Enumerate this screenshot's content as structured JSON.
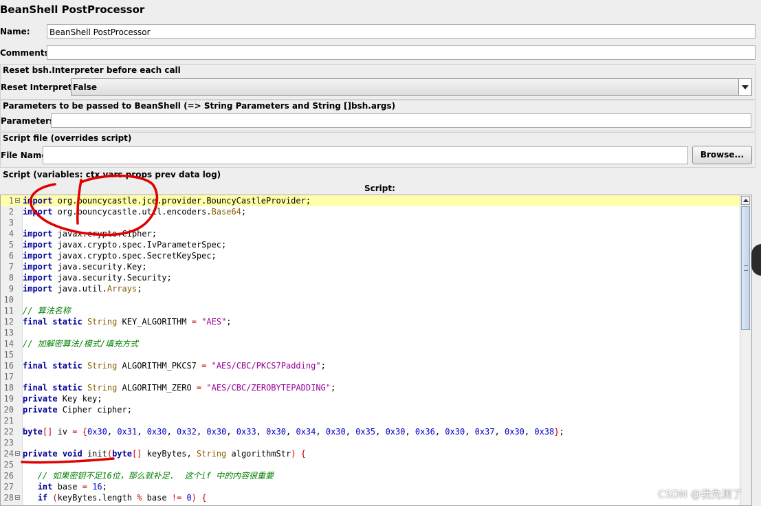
{
  "panel": {
    "title": "BeanShell PostProcessor"
  },
  "name": {
    "label": "Name:",
    "value": "BeanShell PostProcessor"
  },
  "comments": {
    "label": "Comments:",
    "value": ""
  },
  "reset": {
    "section_title": "Reset bsh.Interpreter before each call",
    "label": "Reset Interpreter:",
    "value": "False"
  },
  "parameters": {
    "section_title": "Parameters to be passed to BeanShell (=> String Parameters and String []bsh.args)",
    "label": "Parameters:",
    "value": ""
  },
  "script_file": {
    "section_title": "Script file (overrides script)",
    "label": "File Name:",
    "value": "",
    "browse_label": "Browse..."
  },
  "script": {
    "section_title": "Script (variables: ctx vars props prev data log)",
    "header": "Script:",
    "lines": [
      "import org.bouncycastle.jce.provider.BouncyCastleProvider;",
      "import org.bouncycastle.util.encoders.Base64;",
      "",
      "import javax.crypto.Cipher;",
      "import javax.crypto.spec.IvParameterSpec;",
      "import javax.crypto.spec.SecretKeySpec;",
      "import java.security.Key;",
      "import java.security.Security;",
      "import java.util.Arrays;",
      "",
      "// 算法名称",
      "final static String KEY_ALGORITHM = \"AES\";",
      "",
      "// 加解密算法/模式/填充方式",
      "",
      "final static String ALGORITHM_PKCS7 = \"AES/CBC/PKCS7Padding\";",
      "",
      "final static String ALGORITHM_ZERO = \"AES/CBC/ZEROBYTEPADDING\";",
      "private Key key;",
      "private Cipher cipher;",
      "",
      "byte[] iv = {0x30, 0x31, 0x30, 0x32, 0x30, 0x33, 0x30, 0x34, 0x30, 0x35, 0x30, 0x36, 0x30, 0x37, 0x30, 0x38};",
      "",
      "private void init(byte[] keyBytes, String algorithmStr) {",
      "",
      "   // 如果密钥不足16位，那么就补足.  这个if 中的内容很重要",
      "   int base = 16;",
      "   if (keyBytes.length % base != 0) {"
    ]
  },
  "watermark": "CSDN @我先测了",
  "colors": {
    "highlight_line": "#ffffaa",
    "annotation": "#e00000"
  }
}
